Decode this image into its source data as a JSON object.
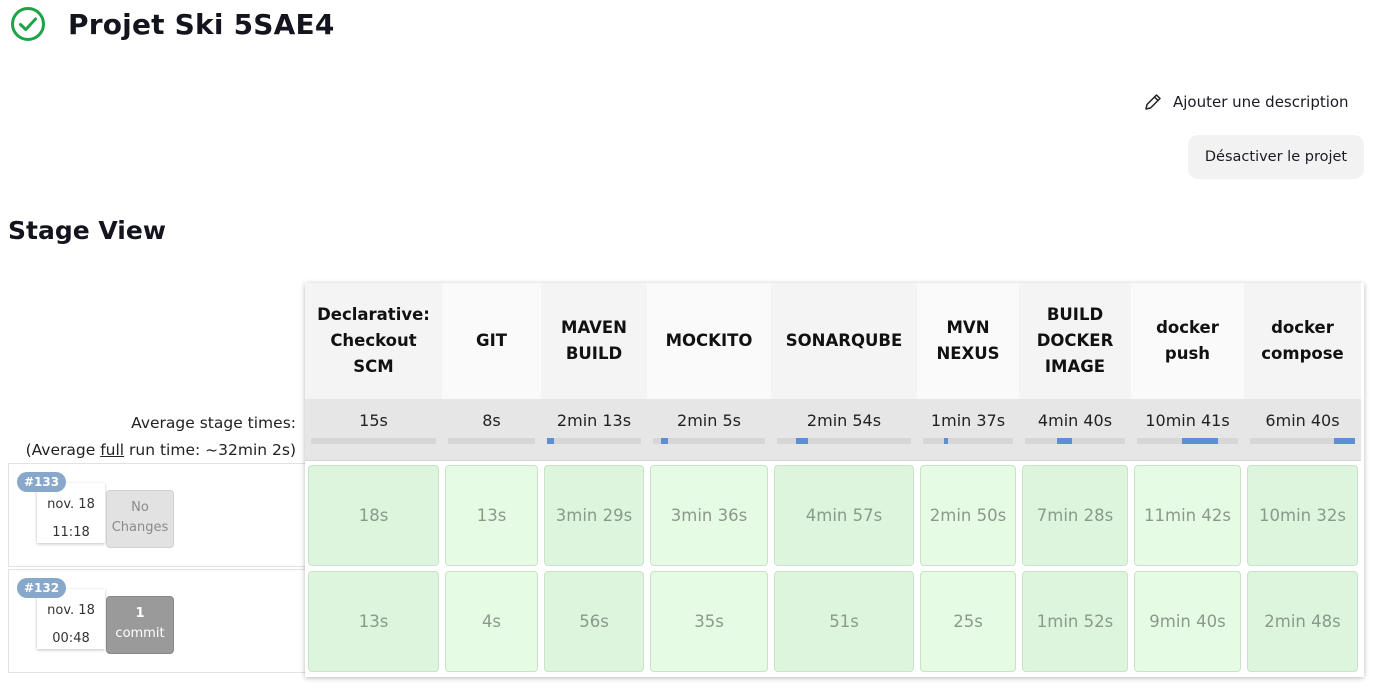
{
  "header": {
    "title": "Projet Ski 5SAE4",
    "status_icon": "check-circle-icon",
    "status_color": "#1ea446"
  },
  "actions": {
    "add_description": "Ajouter une description",
    "disable_project": "Désactiver le projet"
  },
  "stage_view": {
    "title": "Stage View",
    "average_label": "Average stage times:",
    "full_run_prefix": "(Average ",
    "full_run_link": "full",
    "full_run_suffix": " run time: ~32min 2s)",
    "stages": [
      {
        "name": "Declarative: Checkout SCM",
        "avg": "15s",
        "bar_start": 0,
        "bar_frac": 0.0,
        "color": "#f4f4f4"
      },
      {
        "name": "GIT",
        "avg": "8s",
        "bar_start": 0,
        "bar_frac": 0.0,
        "color": "#fafafa"
      },
      {
        "name": "MAVEN BUILD",
        "avg": "2min 13s",
        "bar_start": 0.0,
        "bar_frac": 0.07,
        "color": "#f4f4f4"
      },
      {
        "name": "MOCKITO",
        "avg": "2min 5s",
        "bar_start": 0.07,
        "bar_frac": 0.065,
        "color": "#fafafa"
      },
      {
        "name": "SONARQUBE",
        "avg": "2min 54s",
        "bar_start": 0.14,
        "bar_frac": 0.09,
        "color": "#f4f4f4"
      },
      {
        "name": "MVN NEXUS",
        "avg": "1min 37s",
        "bar_start": 0.23,
        "bar_frac": 0.05,
        "color": "#fafafa"
      },
      {
        "name": "BUILD DOCKER IMAGE",
        "avg": "4min 40s",
        "bar_start": 0.32,
        "bar_frac": 0.15,
        "color": "#f4f4f4"
      },
      {
        "name": "docker push",
        "avg": "10min 41s",
        "bar_start": 0.45,
        "bar_frac": 0.35,
        "color": "#fafafa"
      },
      {
        "name": "docker compose",
        "avg": "6min 40s",
        "bar_start": 0.8,
        "bar_frac": 0.2,
        "color": "#f4f4f4"
      }
    ],
    "runs": [
      {
        "id": "#133",
        "date": "nov. 18",
        "time": "11:18",
        "changes_line1": "No",
        "changes_line2": "Changes",
        "changes_type": "none",
        "durations": [
          "18s",
          "13s",
          "3min 29s",
          "3min 36s",
          "4min 57s",
          "2min 50s",
          "7min 28s",
          "11min 42s",
          "10min 32s"
        ]
      },
      {
        "id": "#132",
        "date": "nov. 18",
        "time": "00:48",
        "changes_line1": "1",
        "changes_line2": "commit",
        "changes_type": "commit",
        "durations": [
          "13s",
          "4s",
          "56s",
          "35s",
          "51s",
          "25s",
          "1min 52s",
          "9min 40s",
          "2min 48s"
        ]
      }
    ],
    "success_colors": [
      "#dcf5dc",
      "#e6fbe4"
    ]
  }
}
